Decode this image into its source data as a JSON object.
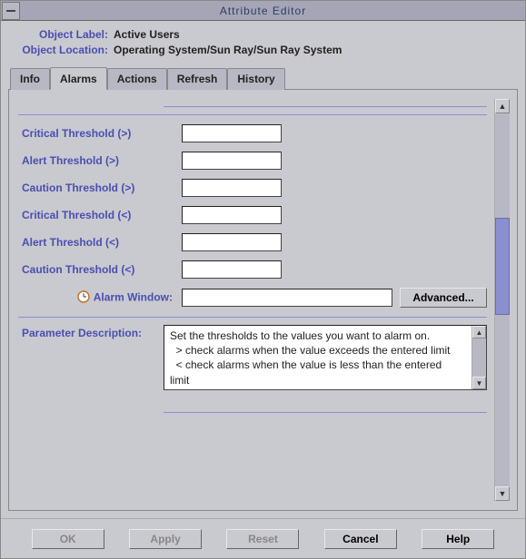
{
  "window": {
    "title": "Attribute Editor"
  },
  "header": {
    "label_object": "Object Label:",
    "value_object": "Active Users",
    "label_location": "Object Location:",
    "value_location": "Operating System/Sun Ray/Sun Ray System"
  },
  "tabs": {
    "info": "Info",
    "alarms": "Alarms",
    "actions": "Actions",
    "refresh": "Refresh",
    "history": "History"
  },
  "fields": {
    "critical_gt": {
      "label": "Critical Threshold (>)",
      "value": ""
    },
    "alert_gt": {
      "label": "Alert Threshold (>)",
      "value": ""
    },
    "caution_gt": {
      "label": "Caution Threshold (>)",
      "value": ""
    },
    "critical_lt": {
      "label": "Critical Threshold (<)",
      "value": ""
    },
    "alert_lt": {
      "label": "Alert Threshold (<)",
      "value": ""
    },
    "caution_lt": {
      "label": "Caution Threshold (<)",
      "value": ""
    },
    "alarm_window": {
      "label": "Alarm Window:",
      "value": ""
    }
  },
  "buttons": {
    "advanced": "Advanced...",
    "ok": "OK",
    "apply": "Apply",
    "reset": "Reset",
    "cancel": "Cancel",
    "help": "Help"
  },
  "description": {
    "label": "Parameter Description:",
    "line1": "Set the thresholds to the values you want to alarm on.",
    "line2": "  > check alarms when the value exceeds the entered limit",
    "line3": "  < check alarms when the value is less than the entered",
    "line4": "limit"
  }
}
